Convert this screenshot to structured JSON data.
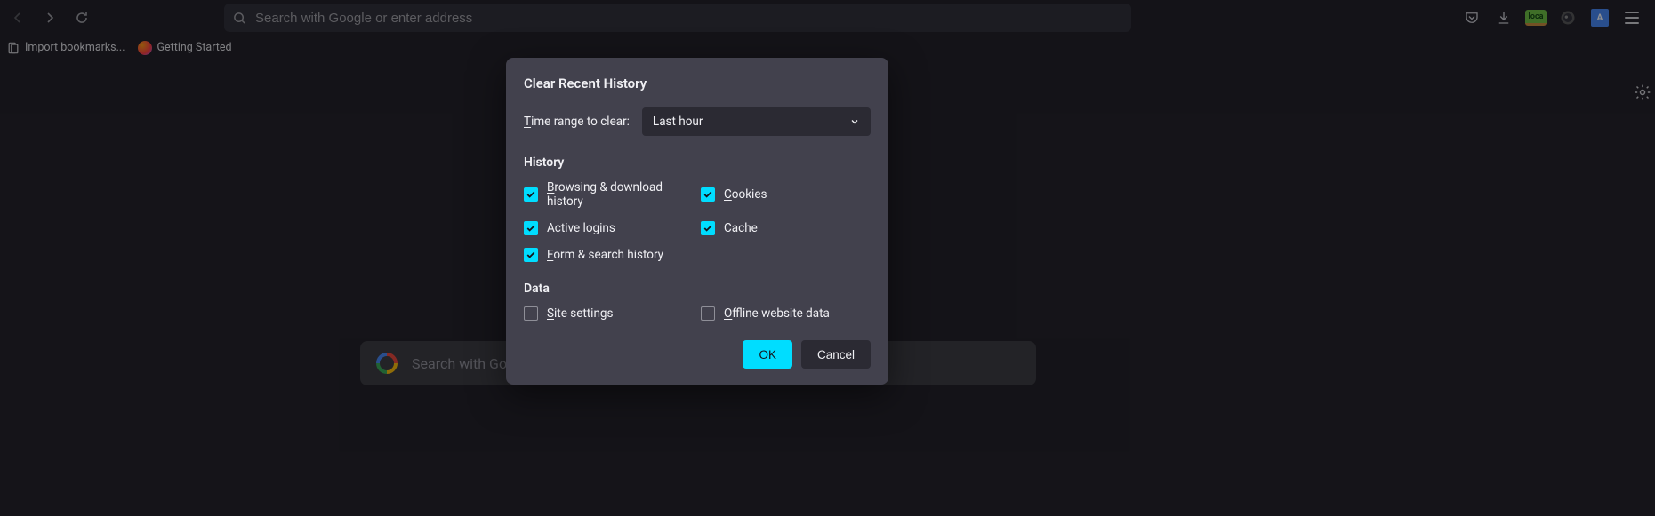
{
  "urlbar": {
    "placeholder": "Search with Google or enter address"
  },
  "bookmarks": {
    "import": "Import bookmarks...",
    "getting_started": "Getting Started"
  },
  "ext_local_label": "loca",
  "search_panel": {
    "placeholder": "Search with Goo"
  },
  "dialog": {
    "title": "Clear Recent History",
    "range_label_pre": "T",
    "range_label_post": "ime range to clear:",
    "range_value": "Last hour",
    "sec_history": "History",
    "sec_data": "Data",
    "chk_browsing_u": "B",
    "chk_browsing_rest": "rowsing & download history",
    "chk_cookies_u": "C",
    "chk_cookies_rest": "ookies",
    "chk_logins_pre": "Active ",
    "chk_logins_u": "l",
    "chk_logins_post": "ogins",
    "chk_cache_pre": "C",
    "chk_cache_u": "a",
    "chk_cache_post": "che",
    "chk_form_u": "F",
    "chk_form_rest": "orm & search history",
    "chk_site_u": "S",
    "chk_site_rest": "ite settings",
    "chk_offline_u": "O",
    "chk_offline_rest": "ffline website data",
    "ok": "OK",
    "cancel": "Cancel"
  }
}
